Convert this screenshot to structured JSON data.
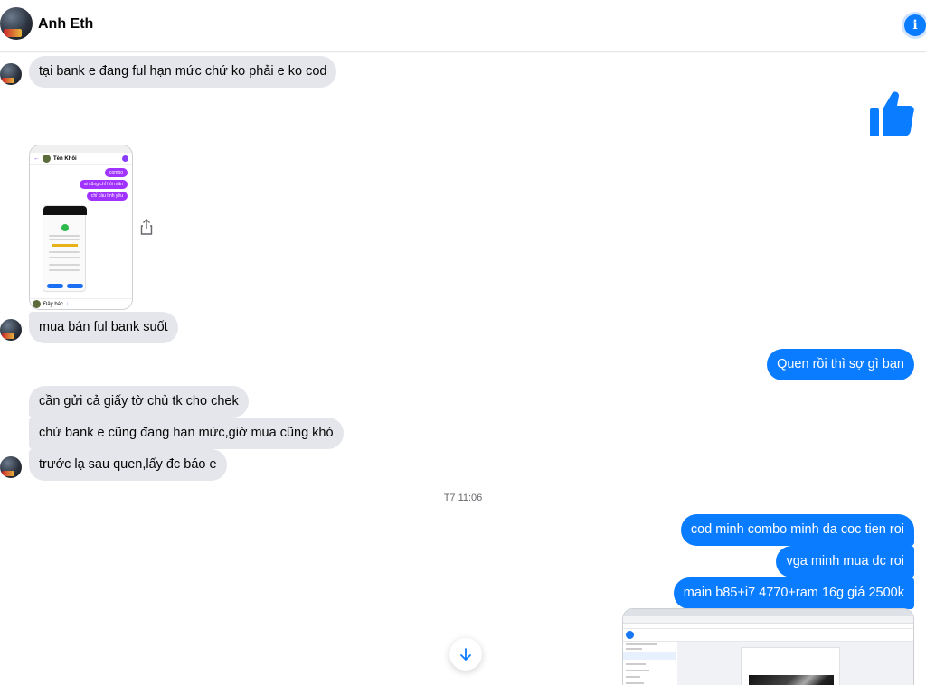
{
  "header": {
    "contact_name": "Anh Eth",
    "info_icon": "info-icon",
    "info_glyph": "i"
  },
  "messages": {
    "m1": "tại bank e đang ful hạn mức chứ ko phải e ko cod",
    "m2": "mua bán ful bank suốt",
    "m3": "Quen rồi thì sợ gì bạn",
    "m4": "cần gửi cả giấy tờ chủ tk cho chek",
    "m5": "chứ bank e cũng đang hạn mức,giờ mua cũng khó",
    "m6": "trước lạ sau quen,lấy đc báo e",
    "m7": "cod minh combo minh da coc tien roi",
    "m8": "vga minh mua dc roi",
    "m9": "main b85+i7 4770+ram 16g giá 2500k"
  },
  "timestamp": "T7 11:06",
  "shared_image": {
    "contact": "Tèn Khôi",
    "bubbles": [
      "combo",
      "ai cũng chỉ hỏi mãn",
      "chỉ cầu tình yêu"
    ],
    "footer": "Đây bác"
  },
  "colors": {
    "outgoing_bubble": "#0a7cff",
    "incoming_bubble": "#e4e6eb",
    "accent": "#0a7cff"
  },
  "icons": {
    "thumbs_up": "thumbs-up-icon",
    "share": "share-icon",
    "react": "smiley-icon",
    "reply": "reply-icon",
    "more": "more-vertical-icon",
    "scroll": "arrow-down-icon"
  }
}
